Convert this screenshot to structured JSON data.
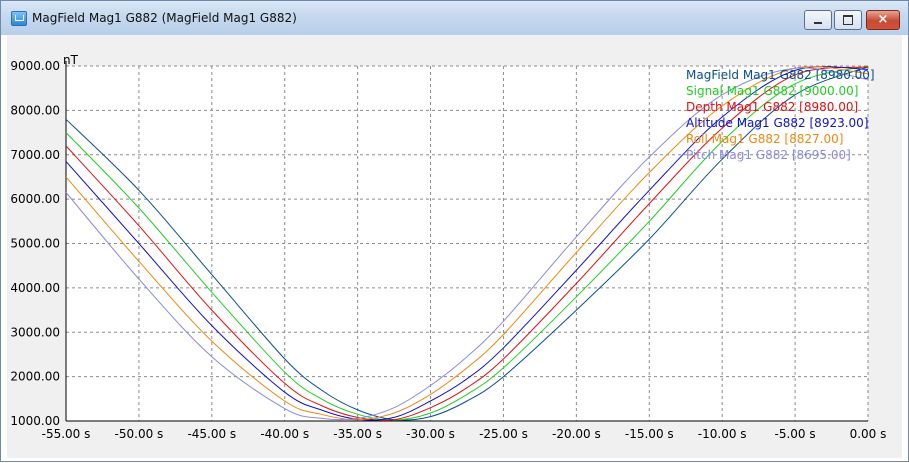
{
  "window": {
    "title": "MagField Mag1 G882 (MagField Mag1 G882)",
    "icon": "app-icon",
    "buttons": {
      "minimize": "minimize-icon",
      "maximize": "maximize-icon",
      "close": "×"
    }
  },
  "chart_data": {
    "type": "line",
    "y_unit_label": "nT",
    "xlim": [
      -55,
      0
    ],
    "ylim": [
      1000,
      9000
    ],
    "x_ticks": [
      -55,
      -50,
      -45,
      -40,
      -35,
      -30,
      -25,
      -20,
      -15,
      -10,
      -5,
      0
    ],
    "x_tick_labels": [
      "-55.00 s",
      "-50.00 s",
      "-45.00 s",
      "-40.00 s",
      "-35.00 s",
      "-30.00 s",
      "-25.00 s",
      "-20.00 s",
      "-15.00 s",
      "-10.00 s",
      "-5.00 s",
      "0.00 s"
    ],
    "y_ticks": [
      1000,
      2000,
      3000,
      4000,
      5000,
      6000,
      7000,
      8000,
      9000
    ],
    "y_tick_labels": [
      "1000.00",
      "2000.00",
      "3000.00",
      "4000.00",
      "5000.00",
      "6000.00",
      "7000.00",
      "8000.00",
      "9000.00"
    ],
    "grid": true,
    "legend_position": "top-right",
    "series": [
      {
        "name": "MagField Mag1 G882",
        "legend": "MagField Mag1 G882 [8980.00]",
        "color": "#0a4f8c",
        "x": [
          -55,
          -50,
          -45,
          -40,
          -37.5,
          -35,
          -32.5,
          -30,
          -27.5,
          -25,
          -20,
          -15,
          -10,
          -5,
          0
        ],
        "y": [
          7800,
          6200,
          4300,
          2400,
          1700,
          1250,
          1030,
          1100,
          1450,
          2000,
          3500,
          5100,
          6900,
          8350,
          8980
        ]
      },
      {
        "name": "Signal Mag1 G882",
        "legend": "Signal Mag1 G882 [9000.00]",
        "color": "#22cc22",
        "x": [
          -55,
          -50,
          -45,
          -40,
          -37.5,
          -35,
          -32.5,
          -30,
          -27.5,
          -25,
          -20,
          -15,
          -10,
          -5,
          0
        ],
        "y": [
          7500,
          5800,
          3900,
          2100,
          1500,
          1150,
          1020,
          1180,
          1600,
          2200,
          3800,
          5500,
          7300,
          8600,
          9000
        ]
      },
      {
        "name": "Depth Mag1 G882",
        "legend": "Depth Mag1 G882 [8980.00]",
        "color": "#dd1111",
        "x": [
          -55,
          -50,
          -45,
          -40,
          -37.5,
          -35,
          -32.5,
          -30,
          -27.5,
          -25,
          -20,
          -15,
          -10,
          -5,
          0
        ],
        "y": [
          7200,
          5400,
          3500,
          1850,
          1350,
          1080,
          1030,
          1300,
          1750,
          2400,
          4100,
          5900,
          7600,
          8800,
          8980
        ]
      },
      {
        "name": "Altitude Mag1 G882",
        "legend": "Altitude Mag1 G882 [8923.00]",
        "color": "#1111cc",
        "x": [
          -55,
          -50,
          -45,
          -40,
          -37.5,
          -35,
          -32.5,
          -30,
          -27.5,
          -25,
          -20,
          -15,
          -10,
          -5,
          0
        ],
        "y": [
          6850,
          5000,
          3150,
          1650,
          1250,
          1040,
          1080,
          1450,
          1950,
          2650,
          4400,
          6200,
          7850,
          8900,
          8923
        ]
      },
      {
        "name": "Roll Mag1 G882",
        "legend": "Roll Mag1 G882 [8827.00]",
        "color": "#ee8811",
        "x": [
          -55,
          -50,
          -45,
          -40,
          -37.5,
          -35,
          -32.5,
          -30,
          -27.5,
          -25,
          -20,
          -15,
          -10,
          -5,
          0
        ],
        "y": [
          6500,
          4600,
          2800,
          1450,
          1150,
          1030,
          1180,
          1600,
          2200,
          2950,
          4800,
          6600,
          8100,
          8950,
          8827
        ]
      },
      {
        "name": "Pitch Mag1 G882",
        "legend": "Pitch Mag1 G882 [8695.00]",
        "color": "#8a8ae0",
        "x": [
          -55,
          -50,
          -45,
          -40,
          -37.5,
          -35,
          -32.5,
          -30,
          -27.5,
          -25,
          -20,
          -15,
          -10,
          -5,
          0
        ],
        "y": [
          6150,
          4200,
          2450,
          1280,
          1060,
          1060,
          1300,
          1800,
          2450,
          3250,
          5150,
          6950,
          8350,
          8950,
          8695
        ]
      }
    ]
  }
}
